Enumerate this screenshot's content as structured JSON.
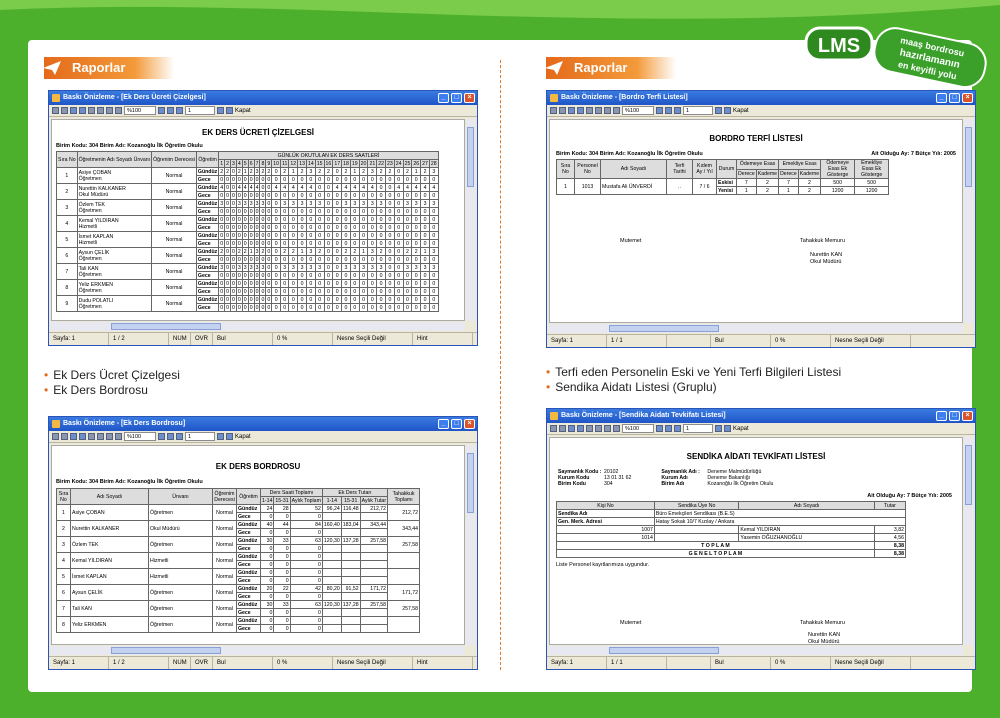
{
  "brand": {
    "logo": "LMS",
    "tagline_1": "maaş bordrosu",
    "tagline_2": "hazırlamanın",
    "tagline_3": "en keyifli yolu"
  },
  "colors": {
    "green": "#4cb02c",
    "orange": "#e46a1a",
    "titlebar": "#1f55c8"
  },
  "section_label_left": "Raporlar",
  "section_label_right": "Raporlar",
  "win_common": {
    "zoom": "%100",
    "close": "Kapat",
    "page": "1",
    "status_num": "NUM",
    "status_ovr": "OVR",
    "status_bul": "Bul",
    "status_pct": "0 %",
    "status_nesne": "Nesne Seçili Değil",
    "status_hint": "Hint"
  },
  "win1": {
    "title": "Baskı Önizleme - [Ek Ders Ücreti Çizelgesi]",
    "doc_title": "EK DERS ÜCRETİ ÇİZELGESİ",
    "birim": "Birim Kodu: 304  Birim Adı: Kozanoğlu İlk Öğretim Okulu",
    "status_sayfa": "Sayfa: 1",
    "status_pages": "1 / 2",
    "h_sira": "Sıra No",
    "h_ad": "Öğretmenin Adı Soyadı Ünvanı",
    "h_derece": "Öğrenim Derecesi",
    "h_ogretim": "Öğretim",
    "h_gunluk": "GÜNLÜK OKUTULAN EK DERS SAATLERİ",
    "days": [
      "1",
      "2",
      "3",
      "4",
      "5",
      "6",
      "7",
      "8",
      "9",
      "10",
      "11",
      "12",
      "13",
      "14",
      "15",
      "16",
      "17",
      "18",
      "19",
      "20",
      "21",
      "22",
      "23",
      "24",
      "25",
      "26",
      "27",
      "28"
    ],
    "rows": [
      {
        "no": "1",
        "name": "Asiye ÇOBAN",
        "title": "Öğretmen",
        "deg": "Normal",
        "g": "2 2 0 2 1 2 3 2 2 0 2 1 2 3 2 2 0 2 1 2 3 2 2 0 2 1 2 3",
        "c": "0 0 0 0 0 0 0 0 0 0 0 0 0 0 0 0 0 0 0 0 0 0 0 0 0 0 0 0"
      },
      {
        "no": "2",
        "name": "Nurettin KALKANER",
        "title": "Okul Müdürü",
        "deg": "Normal",
        "g": "4 0 0 4 4 4 4 0 0 4 4 4 4 4 0 0 4 4 4 4 4 0 0 4 4 4 4 4",
        "c": "0 0 0 0 0 0 0 0 0 0 0 0 0 0 0 0 0 0 0 0 0 0 0 0 0 0 0 0"
      },
      {
        "no": "3",
        "name": "Özlem TEK",
        "title": "Öğretmen",
        "deg": "Normal",
        "g": "3 0 0 3 3 3 3 3 0 0 3 3 3 3 3 0 0 3 3 3 3 3 0 0 3 3 3 3",
        "c": "0 0 0 0 0 0 0 0 0 0 0 0 0 0 0 0 0 0 0 0 0 0 0 0 0 0 0 0"
      },
      {
        "no": "4",
        "name": "Kemal YILDIRAN",
        "title": "Hizmetli",
        "deg": "Normal",
        "g": "0 0 0 0 0 0 0 0 0 0 0 0 0 0 0 0 0 0 0 0 0 0 0 0 0 0 0 0",
        "c": "0 0 0 0 0 0 0 0 0 0 0 0 0 0 0 0 0 0 0 0 0 0 0 0 0 0 0 0"
      },
      {
        "no": "5",
        "name": "İsmet KAPLAN",
        "title": "Hizmetli",
        "deg": "Normal",
        "g": "0 0 0 0 0 0 0 0 0 0 0 0 0 0 0 0 0 0 0 0 0 0 0 0 0 0 0 0",
        "c": "0 0 0 0 0 0 0 0 0 0 0 0 0 0 0 0 0 0 0 0 0 0 0 0 0 0 0 0"
      },
      {
        "no": "6",
        "name": "Aysun ÇELİK",
        "title": "Öğretmen",
        "deg": "Normal",
        "g": "2 0 0 2 2 1 3 2 0 0 2 2 1 3 2 0 0 2 2 1 3 2 0 0 2 2 1 3",
        "c": "0 0 0 0 0 0 0 0 0 0 0 0 0 0 0 0 0 0 0 0 0 0 0 0 0 0 0 0"
      },
      {
        "no": "7",
        "name": "Tali KAN",
        "title": "Öğretmen",
        "deg": "Normal",
        "g": "3 0 0 3 3 3 3 3 0 0 3 3 3 3 3 0 0 3 3 3 3 3 0 0 3 3 3 3",
        "c": "0 0 0 0 0 0 0 0 0 0 0 0 0 0 0 0 0 0 0 0 0 0 0 0 0 0 0 0"
      },
      {
        "no": "8",
        "name": "Yeliz ERKMEN",
        "title": "Öğretmen",
        "deg": "Normal",
        "g": "0 0 0 0 0 0 0 0 0 0 0 0 0 0 0 0 0 0 0 0 0 0 0 0 0 0 0 0",
        "c": "0 0 0 0 0 0 0 0 0 0 0 0 0 0 0 0 0 0 0 0 0 0 0 0 0 0 0 0"
      },
      {
        "no": "9",
        "name": "Dudu POLATLI",
        "title": "Öğretmen",
        "deg": "Normal",
        "g": "0 0 0 0 0 0 0 0 0 0 0 0 0 0 0 0 0 0 0 0 0 0 0 0 0 0 0 0",
        "c": "0 0 0 0 0 0 0 0 0 0 0 0 0 0 0 0 0 0 0 0 0 0 0 0 0 0 0 0"
      }
    ],
    "gunduz": "Gündüz",
    "gece": "Gece"
  },
  "win2": {
    "title": "Baskı Önizleme - [Bordro Terfi Listesi]",
    "doc_title": "BORDRO TERFİ LİSTESİ",
    "birim": "Birim Kodu: 304  Birim Adı: Kozanoğlu İlk Öğretim Okulu",
    "donem": "Ait Olduğu Ay: 7  Bütçe Yılı: 2005",
    "status_sayfa": "Sayfa: 1",
    "status_pages": "1 / 1",
    "h": [
      "Sıra No",
      "Personel No",
      "Adı Soyadı",
      "Terfi Tarihi",
      "Kıdem Ay / Yıl",
      "Durum",
      "Ödemeye Esas",
      "Emekliye Esas",
      "Ödemeye Esas Ek Gösterge",
      "Emekliye Esas Ek Gösterge"
    ],
    "sub": [
      "Derece",
      "Kademe",
      "Derece",
      "Kademe"
    ],
    "row": {
      "no": "1",
      "pno": "1013",
      "name": "Mustafa Ali ÜNVERDİ",
      "date": "..",
      "kidem": "7 / 6"
    },
    "eski": {
      "label": "Eskisi",
      "v": [
        "7",
        "2",
        "7",
        "2",
        "500",
        "500"
      ]
    },
    "yeni": {
      "label": "Yenisi",
      "v": [
        "1",
        "2",
        "1",
        "2",
        "1200",
        "1200"
      ]
    },
    "mutemet": "Mutemet",
    "tahakkuk": "Tahakkuk Memuru",
    "signer": "Nurettin KAN",
    "signer_title": "Okul Müdürü"
  },
  "bullets_left": [
    "Ek Ders Ücret Çizelgesi",
    "Ek Ders Bordrosu"
  ],
  "bullets_right": [
    "Terfi eden Personelin Eski ve Yeni Terfi Bilgileri Listesi",
    "Sendika Aidatı Listesi (Gruplu)"
  ],
  "win3": {
    "title": "Baskı Önizleme - [Ek Ders Bordrosu]",
    "doc_title": "EK DERS BORDROSU",
    "birim": "Birim Kodu: 304  Birim Adı: Kozanoğlu İlk Öğretim Okulu",
    "status_sayfa": "Sayfa: 1",
    "status_pages": "1 / 2",
    "h": [
      "Sıra No",
      "Adı Soyadı",
      "Ünvanı",
      "Öğrenim Derecesi",
      "Öğretim",
      "Ders Saati Toplamı",
      "Ek Ders Tutarı",
      "Tahakkuk Toplamı"
    ],
    "sub": [
      "1-14",
      "15-31",
      "Aylık Toplam",
      "1-14",
      "15-31",
      "Aylık Tutar"
    ],
    "rows": [
      {
        "no": "1",
        "name": "Asiye ÇOBAN",
        "title": "Öğretmen",
        "deg": "Normal",
        "g": [
          "24",
          "28",
          "52",
          "96,24",
          "116,48",
          "212,72"
        ],
        "c": [
          "0",
          "0",
          "0",
          "",
          "",
          ""
        ],
        "tot": "212,72"
      },
      {
        "no": "2",
        "name": "Nurettin KALKANER",
        "title": "Okul Müdürü",
        "deg": "Normal",
        "g": [
          "40",
          "44",
          "84",
          "160,40",
          "183,04",
          "343,44"
        ],
        "c": [
          "0",
          "0",
          "0",
          "",
          "",
          ""
        ],
        "tot": "343,44"
      },
      {
        "no": "3",
        "name": "Özlem TEK",
        "title": "Öğretmen",
        "deg": "Normal",
        "g": [
          "30",
          "33",
          "63",
          "120,30",
          "137,28",
          "257,58"
        ],
        "c": [
          "0",
          "0",
          "0",
          "",
          "",
          ""
        ],
        "tot": "257,58"
      },
      {
        "no": "4",
        "name": "Kemal YILDIRAN",
        "title": "Hizmetli",
        "deg": "Normal",
        "g": [
          "0",
          "0",
          "0",
          "",
          "",
          ""
        ],
        "c": [
          "0",
          "0",
          "0",
          "",
          "",
          ""
        ],
        "tot": ""
      },
      {
        "no": "5",
        "name": "İsmet KAPLAN",
        "title": "Hizmetli",
        "deg": "Normal",
        "g": [
          "0",
          "0",
          "0",
          "",
          "",
          ""
        ],
        "c": [
          "0",
          "0",
          "0",
          "",
          "",
          ""
        ],
        "tot": ""
      },
      {
        "no": "6",
        "name": "Aysun ÇELİK",
        "title": "Öğretmen",
        "deg": "Normal",
        "g": [
          "20",
          "22",
          "42",
          "80,20",
          "91,52",
          "171,72"
        ],
        "c": [
          "0",
          "0",
          "0",
          "",
          "",
          ""
        ],
        "tot": "171,72"
      },
      {
        "no": "7",
        "name": "Tali KAN",
        "title": "Öğretmen",
        "deg": "Normal",
        "g": [
          "30",
          "33",
          "63",
          "120,30",
          "137,28",
          "257,58"
        ],
        "c": [
          "0",
          "0",
          "0",
          "",
          "",
          ""
        ],
        "tot": "257,58"
      },
      {
        "no": "8",
        "name": "Yeliz ERKMEN",
        "title": "Öğretmen",
        "deg": "Normal",
        "g": [
          "0",
          "0",
          "0",
          "",
          "",
          ""
        ],
        "c": [
          "0",
          "0",
          "0",
          "",
          "",
          ""
        ],
        "tot": ""
      }
    ],
    "gunduz": "Gündüz",
    "gece": "Gece"
  },
  "win4": {
    "title": "Baskı Önizleme - [Sendika Aidatı Tevkifatı Listesi]",
    "doc_title": "SENDİKA AİDATI TEVKİFATI LİSTESİ",
    "status_sayfa": "Sayfa: 1",
    "status_pages": "1 / 1",
    "info_l": [
      [
        "Saymanlık Kodu :",
        "20102"
      ],
      [
        "Kurum Kodu",
        "13 01 31 62"
      ],
      [
        "Birim Kodu",
        "304"
      ]
    ],
    "info_r": [
      [
        "Saymanlık Adı :",
        "Deneme Malmüdürlüğü"
      ],
      [
        "Kurum Adı",
        "Deneme Bakanlığı"
      ],
      [
        "Birim Adı",
        "Kozanoğlu İlk Öğretim Okulu"
      ]
    ],
    "donem": "Ait Olduğu Ay: 7  Bütçe Yılı: 2005",
    "h": [
      "Kişi No",
      "Sendika Üye No",
      "Adı Soyadı",
      "Tutar"
    ],
    "s_label": "Sendika Adı",
    "s_val": "Büro Emekçileri Sendikası (B.E.S)",
    "g_label": "Gen. Merk. Adresi",
    "g_val": "Hatay Sokak 10/7 Kızılay / Ankara",
    "rows": [
      {
        "no": "1007",
        "name": "Kemal YILDIRAN",
        "amt": "3,82"
      },
      {
        "no": "1014",
        "name": "Yasemin OĞUZHANOĞLU",
        "amt": "4,56"
      }
    ],
    "toplam": "T O P L A M",
    "toplam_v": "8,38",
    "genel": "G E N E L   T O P L A M",
    "genel_v": "8,38",
    "note": "Liste Personel kayıtlarımıza uygundur.",
    "mutemet": "Mutemet",
    "tahakkuk": "Tahakkuk Memuru",
    "signer": "Nurettin KAN",
    "signer_title": "Okul Müdürü"
  }
}
